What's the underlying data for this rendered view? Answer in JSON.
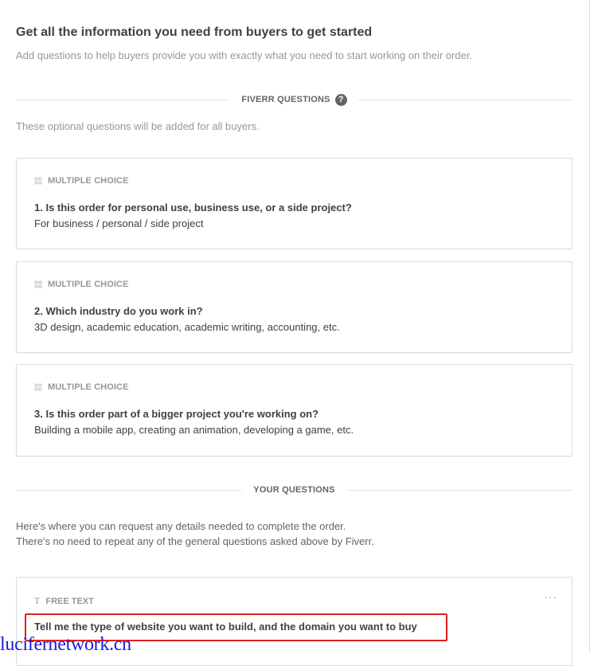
{
  "header": {
    "title": "Get all the information you need from buyers to get started",
    "subtitle": "Add questions to help buyers provide you with exactly what you need to start working on their order."
  },
  "fiverr_section": {
    "label": "FIVERR QUESTIONS",
    "help_icon": "?",
    "note": "These optional questions will be added for all buyers."
  },
  "questions": [
    {
      "type": "MULTIPLE CHOICE",
      "question": "1. Is this order for personal use, business use, or a side project?",
      "answer": "For business / personal / side project"
    },
    {
      "type": "MULTIPLE CHOICE",
      "question": "2. Which industry do you work in?",
      "answer": "3D design, academic education, academic writing, accounting, etc."
    },
    {
      "type": "MULTIPLE CHOICE",
      "question": "3. Is this order part of a bigger project you're working on?",
      "answer": "Building a mobile app, creating an animation, developing a game, etc."
    }
  ],
  "your_section": {
    "label": "YOUR QUESTIONS",
    "note_line1": "Here's where you can request any details needed to complete the order.",
    "note_line2": "There's no need to repeat any of the general questions asked above by Fiverr."
  },
  "free_text_card": {
    "type_icon": "T",
    "type": "FREE TEXT",
    "more_icon": "···",
    "question": "Tell me the type of website you want to build, and the domain you want to buy"
  },
  "highlight_color": "#e02020",
  "watermark": "lucifernetwork.cn"
}
